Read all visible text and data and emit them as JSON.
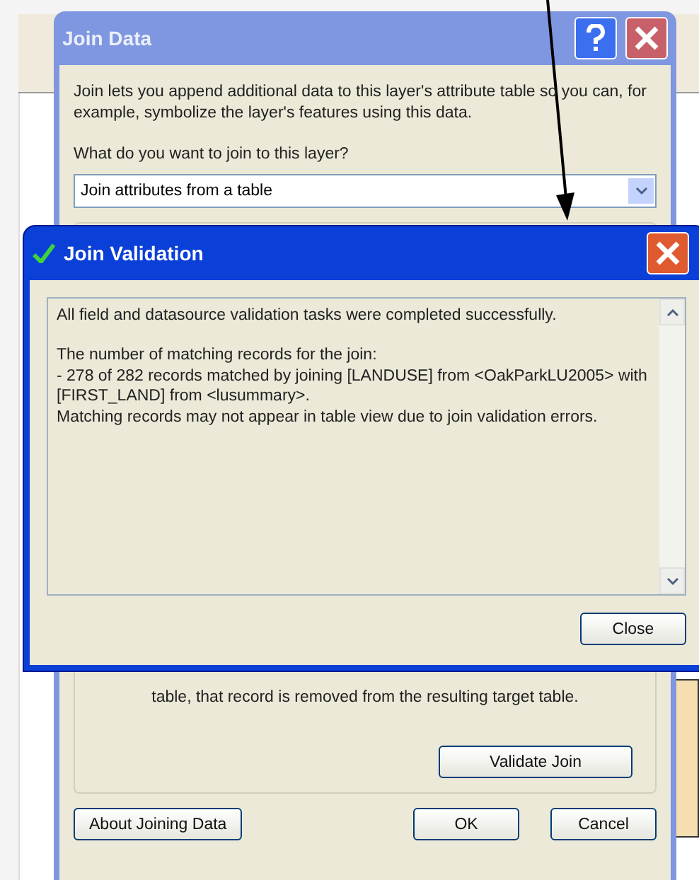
{
  "join_data": {
    "title": "Join Data",
    "intro": "Join lets you append additional data to this layer's attribute table so you can, for example, symbolize the layer's features using this data.",
    "question": "What do you want to join to this layer?",
    "join_type": {
      "value": "Join attributes from a table"
    },
    "note": "table, that record is removed from the resulting target table.",
    "validate_button": "Validate Join",
    "about_button": "About Joining Data",
    "ok_button": "OK",
    "cancel_button": "Cancel"
  },
  "join_validation": {
    "title": "Join Validation",
    "summary": "All field and datasource validation tasks were completed successfully.",
    "details": [
      "The number of matching records for the join:",
      "- 278 of 282 records matched by joining [LANDUSE] from <OakParkLU2005> with [FIRST_LAND] from <lusummary>.",
      "Matching records may not appear in table view due to join validation errors."
    ],
    "close_button": "Close"
  }
}
